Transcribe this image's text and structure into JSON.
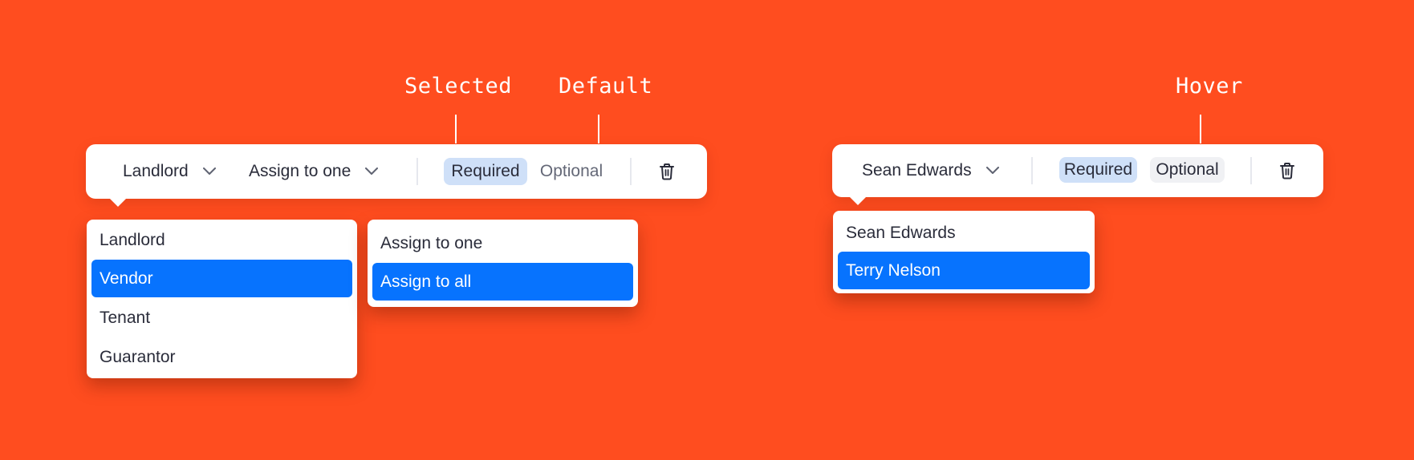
{
  "annotations": {
    "selected": "Selected",
    "default": "Default",
    "hover": "Hover"
  },
  "left_toolbar": {
    "role_select": "Landlord",
    "assign_select": "Assign to one",
    "required_label": "Required",
    "optional_label": "Optional",
    "required_state": "selected",
    "optional_state": "default"
  },
  "right_toolbar": {
    "person_select": "Sean Edwards",
    "required_label": "Required",
    "optional_label": "Optional",
    "required_state": "selected",
    "optional_state": "hover"
  },
  "role_menu": {
    "items": [
      "Landlord",
      "Vendor",
      "Tenant",
      "Guarantor"
    ],
    "highlighted": "Vendor"
  },
  "assign_menu": {
    "items": [
      "Assign to one",
      "Assign to all"
    ],
    "highlighted": "Assign to all"
  },
  "person_menu": {
    "items": [
      "Sean Edwards",
      "Terry Nelson"
    ],
    "highlighted": "Terry Nelson"
  },
  "colors": {
    "background": "#FF4D1F",
    "highlight": "#0773FE",
    "selected_pill": "#CFE0F8",
    "hover_pill": "#F0F1F4"
  },
  "icons": [
    "chevron-down-icon",
    "trash-icon"
  ]
}
